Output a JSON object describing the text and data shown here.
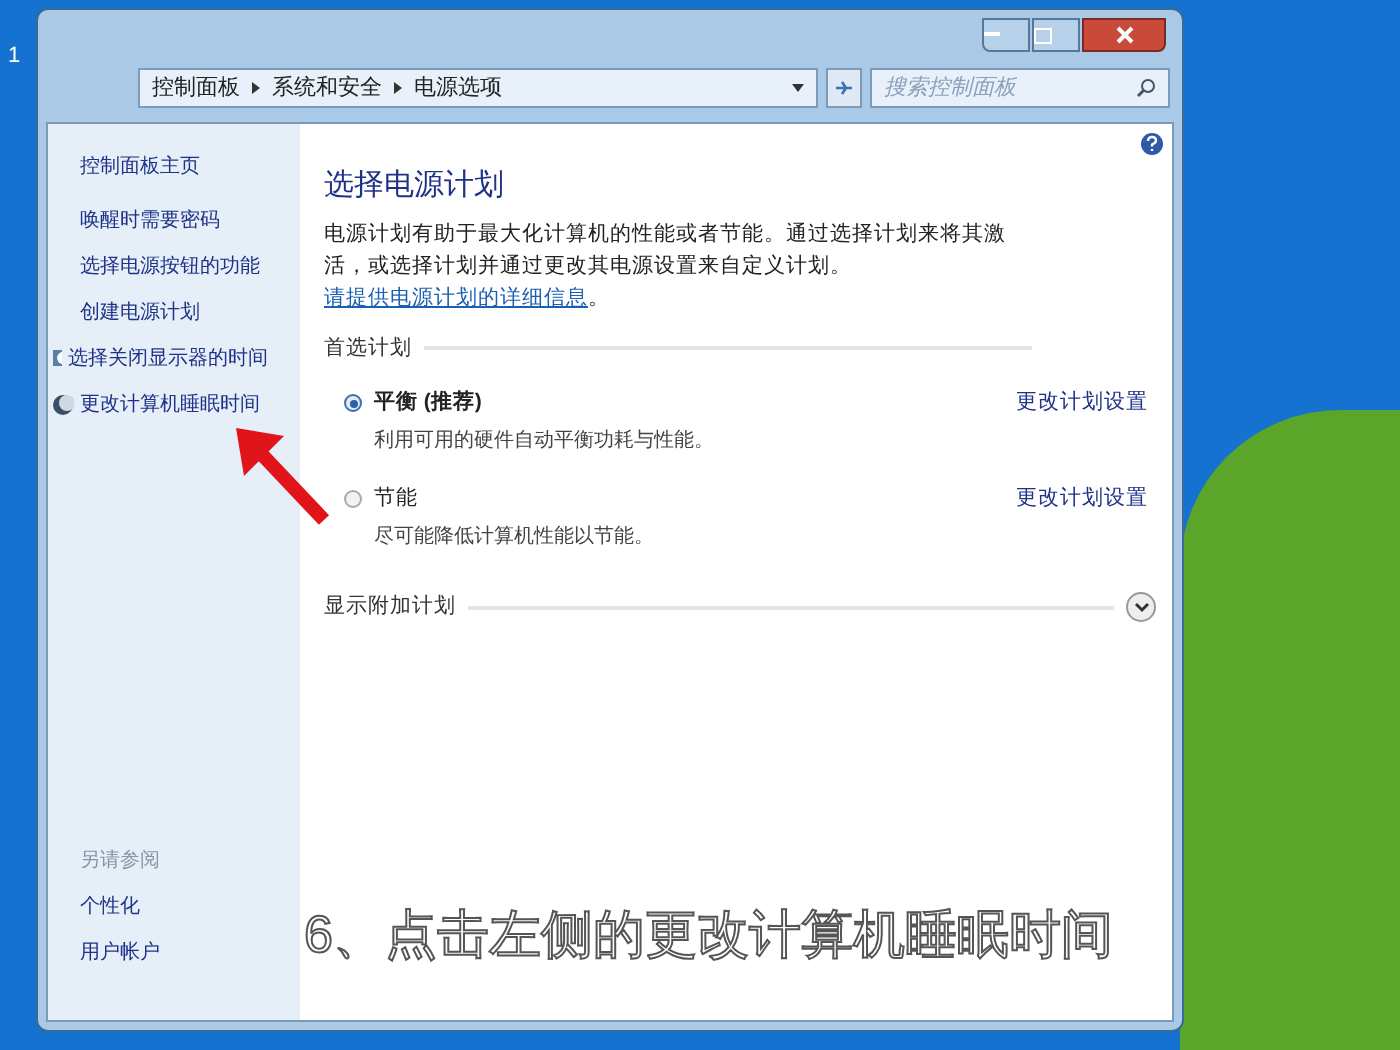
{
  "desktop": {
    "corner_label": "1"
  },
  "window": {
    "breadcrumb": [
      "控制面板",
      "系统和安全",
      "电源选项"
    ],
    "search": {
      "placeholder": "搜索控制面板"
    }
  },
  "sidebar": {
    "items": [
      {
        "label": "控制面板主页",
        "kind": "home"
      },
      {
        "label": "唤醒时需要密码",
        "kind": "link"
      },
      {
        "label": "选择电源按钮的功能",
        "kind": "link"
      },
      {
        "label": "创建电源计划",
        "kind": "link"
      },
      {
        "label": "选择关闭显示器的时间",
        "kind": "monitor"
      },
      {
        "label": "更改计算机睡眠时间",
        "kind": "moon"
      }
    ],
    "see_also": {
      "title": "另请参阅",
      "items": [
        "个性化",
        "用户帐户"
      ]
    }
  },
  "content": {
    "title": "选择电源计划",
    "description": "电源计划有助于最大化计算机的性能或者节能。通过选择计划来将其激活，或选择计划并通过更改其电源设置来自定义计划。",
    "link": "请提供电源计划的详细信息",
    "link_end": "。",
    "section": "首选计划",
    "plans": [
      {
        "name": "平衡 (推荐)",
        "description": "利用可用的硬件自动平衡功耗与性能。",
        "selected": true,
        "action": "更改计划设置"
      },
      {
        "name": "节能",
        "description": "尽可能降低计算机性能以节能。",
        "selected": false,
        "action": "更改计划设置"
      }
    ],
    "more": {
      "label": "显示附加计划",
      "expanded": false
    }
  },
  "caption": "6、点击左侧的更改计算机睡眠时间"
}
